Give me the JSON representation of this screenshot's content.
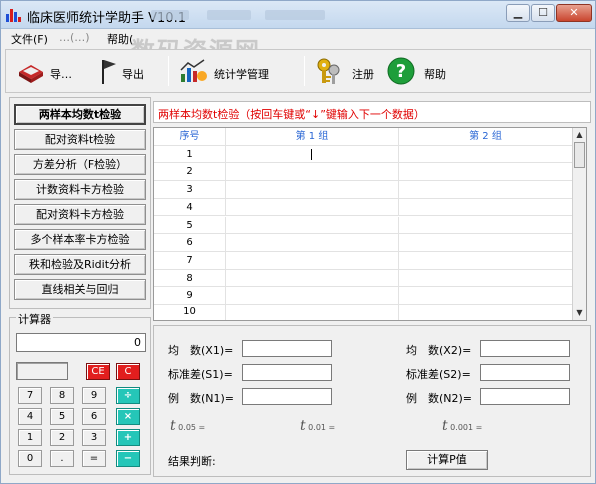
{
  "window": {
    "title": "临床医师统计学助手 V10.1",
    "controls": {
      "minimize": "▁",
      "maximize": "☐",
      "close": "✕"
    }
  },
  "menu": [
    {
      "label": "文件(F)"
    },
    {
      "label": "…(…)"
    },
    {
      "label": "帮助("
    }
  ],
  "watermark": "数码资源网",
  "toolbar": {
    "items": [
      {
        "label": "导…",
        "icon": "book-icon"
      },
      {
        "label": "导出",
        "icon": "flag-icon"
      },
      {
        "label": "统计学管理",
        "icon": "chart-icon"
      },
      {
        "label": "注册",
        "icon": "keys-icon"
      },
      {
        "label": "帮助",
        "icon": "help-icon"
      }
    ]
  },
  "functions": [
    {
      "label": "两样本均数t检验",
      "active": true
    },
    {
      "label": "配对资料t检验",
      "active": false
    },
    {
      "label": "方差分析（F检验）",
      "active": false
    },
    {
      "label": "计数资料卡方检验",
      "active": false
    },
    {
      "label": "配对资料卡方检验",
      "active": false
    },
    {
      "label": "多个样本率卡方检验",
      "active": false
    },
    {
      "label": "秩和检验及Ridit分析",
      "active": false
    },
    {
      "label": "直线相关与回归",
      "active": false
    }
  ],
  "calculator": {
    "title": "计算器",
    "display": "0",
    "keys": [
      [
        "",
        "",
        "CE",
        "C"
      ],
      [
        "7",
        "8",
        "9",
        "÷"
      ],
      [
        "4",
        "5",
        "6",
        "×"
      ],
      [
        "1",
        "2",
        "3",
        "+"
      ],
      [
        "0",
        ".",
        "=",
        "−"
      ]
    ]
  },
  "grid": {
    "instruction": "两样本均数t检验（按回车键或“↓”键输入下一个数据）",
    "columns": [
      "序号",
      "第 1 组",
      "第 2 组"
    ],
    "rows": [
      "1",
      "2",
      "3",
      "4",
      "5",
      "6",
      "7",
      "8",
      "9",
      "10"
    ],
    "scroll_up": "▲",
    "scroll_down": "▼"
  },
  "results": {
    "mean1_label": "均　数(X1)=",
    "mean2_label": "均　数(X2)=",
    "sd1_label": "标准差(S1)=",
    "sd2_label": "标准差(S2)=",
    "n1_label": "例　数(N1)=",
    "n2_label": "例　数(N2)=",
    "t_levels": [
      {
        "symbol": "t",
        "sub": " 0.05 ="
      },
      {
        "symbol": "t",
        "sub": " 0.01 ="
      },
      {
        "symbol": "t",
        "sub": " 0.001 ="
      }
    ],
    "conclusion_label": "结果判断:",
    "calc_button": "计算P值"
  },
  "colors": {
    "instruction_red": "#e00000",
    "grid_header_blue": "#2966d4",
    "ce_red": "#e21e1e",
    "op_teal": "#25c6b8"
  }
}
